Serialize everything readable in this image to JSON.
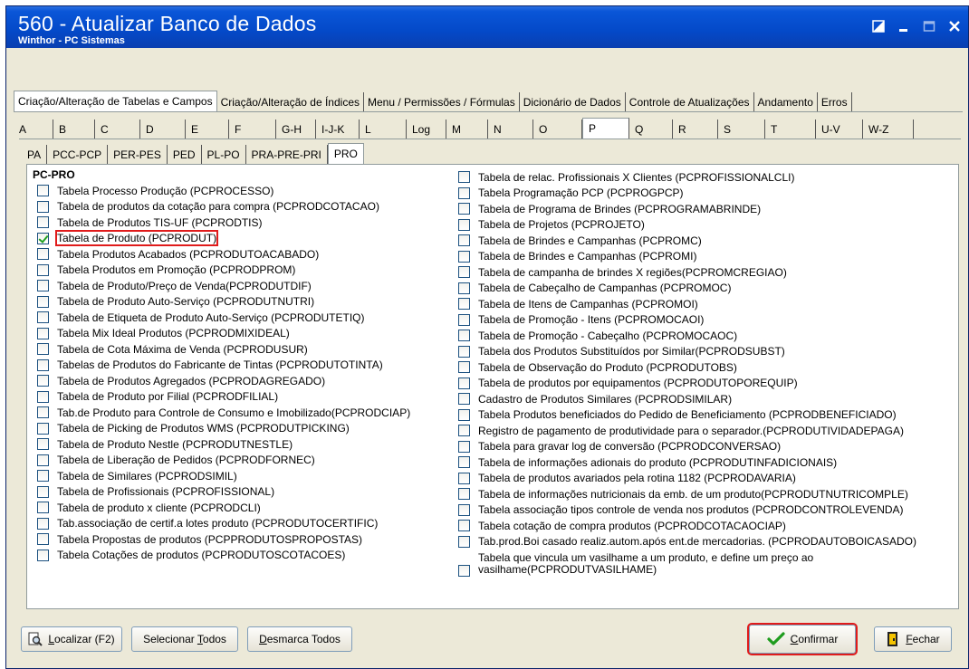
{
  "window": {
    "title": "560 - Atualizar Banco de Dados",
    "subtitle": "Winthor - PC Sistemas"
  },
  "main_tabs": [
    {
      "label": "Criação/Alteração de Tabelas e Campos",
      "active": true
    },
    {
      "label": "Criação/Alteração de Índices"
    },
    {
      "label": "Menu / Permissões / Fórmulas"
    },
    {
      "label": "Dicionário de Dados"
    },
    {
      "label": "Controle de Atualizações"
    },
    {
      "label": "Andamento"
    },
    {
      "label": "Erros"
    }
  ],
  "letter_tabs": [
    "A",
    "B",
    "C",
    "D",
    "E",
    "F",
    "G-H",
    "I-J-K",
    "L",
    "Log",
    "M",
    "N",
    "O",
    "P",
    "Q",
    "R",
    "S",
    "T",
    "U-V",
    "W-Z"
  ],
  "active_letter": "P",
  "sub_tabs": [
    "PA",
    "PCC-PCP",
    "PER-PES",
    "PED",
    "PL-PO",
    "PRA-PRE-PRI",
    "PRO"
  ],
  "active_sub": "PRO",
  "group_label": "PC-PRO",
  "left_items": [
    {
      "label": "Tabela Processo Produção (PCPROCESSO)"
    },
    {
      "label": "Tabela de produtos da cotação para compra (PCPRODCOTACAO)"
    },
    {
      "label": "Tabela de Produtos TIS-UF (PCPRODTIS)"
    },
    {
      "label": "Tabela de Produto (PCPRODUT)",
      "checked": true,
      "highlight": true
    },
    {
      "label": "Tabela Produtos Acabados (PCPRODUTOACABADO)"
    },
    {
      "label": "Tabela Produtos em Promoção (PCPRODPROM)"
    },
    {
      "label": "Tabela de Produto/Preço de Venda(PCPRODUTDIF)"
    },
    {
      "label": "Tabela de Produto Auto-Serviço (PCPRODUTNUTRI)"
    },
    {
      "label": "Tabela de Etiqueta de Produto Auto-Serviço (PCPRODUTETIQ)"
    },
    {
      "label": "Tabela Mix Ideal Produtos (PCPRODMIXIDEAL)"
    },
    {
      "label": "Tabela de Cota Máxima de Venda (PCPRODUSUR)"
    },
    {
      "label": "Tabelas de Produtos do Fabricante de Tintas (PCPRODUTOTINTA)"
    },
    {
      "label": "Tabela de Produtos Agregados (PCPRODAGREGADO)"
    },
    {
      "label": "Tabela de Produto por Filial (PCPRODFILIAL)"
    },
    {
      "label": "Tab.de Produto para Controle de Consumo e Imobilizado(PCPRODCIAP)"
    },
    {
      "label": "Tabela de Picking de Produtos WMS (PCPRODUTPICKING)"
    },
    {
      "label": "Tabela de Produto Nestle (PCPRODUTNESTLE)"
    },
    {
      "label": "Tabela de Liberação de Pedidos (PCPRODFORNEC)"
    },
    {
      "label": "Tabela de Similares (PCPRODSIMIL)"
    },
    {
      "label": "Tabela de Profissionais (PCPROFISSIONAL)"
    },
    {
      "label": "Tabela de produto x cliente (PCPRODCLI)"
    },
    {
      "label": "Tab.associação de certif.a lotes produto (PCPRODUTOCERTIFIC)"
    },
    {
      "label": "Tabela Propostas de produtos (PCPPRODUTOSPROPOSTAS)"
    },
    {
      "label": "Tabela Cotações de produtos (PCPRODUTOSCOTACOES)"
    }
  ],
  "right_items": [
    {
      "label": "Tabela de relac. Profissionais X Clientes (PCPROFISSIONALCLI)"
    },
    {
      "label": "Tabela Programação PCP (PCPROGPCP)"
    },
    {
      "label": "Tabela de Programa de Brindes (PCPROGRAMABRINDE)"
    },
    {
      "label": "Tabela de Projetos (PCPROJETO)"
    },
    {
      "label": "Tabela de Brindes e Campanhas  (PCPROMC)"
    },
    {
      "label": "Tabela de Brindes e Campanhas  (PCPROMI)"
    },
    {
      "label": "Tabela de campanha de brindes X regiões(PCPROMCREGIAO)"
    },
    {
      "label": "Tabela de Cabeçalho de Campanhas  (PCPROMOC)"
    },
    {
      "label": "Tabela de Itens de Campanhas  (PCPROMOI)"
    },
    {
      "label": "Tabela de Promoção - Itens (PCPROMOCAOI)"
    },
    {
      "label": "Tabela de Promoção - Cabeçalho (PCPROMOCAOC)"
    },
    {
      "label": "Tabela dos Produtos Substituídos por Similar(PCPRODSUBST)"
    },
    {
      "label": "Tabela de Observação do Produto (PCPRODUTOBS)"
    },
    {
      "label": "Tabela de produtos por equipamentos (PCPRODUTOPOREQUIP)"
    },
    {
      "label": "Cadastro de Produtos Similares (PCPRODSIMILAR)"
    },
    {
      "label": "Tabela Produtos beneficiados do Pedido de Beneficiamento (PCPRODBENEFICIADO)"
    },
    {
      "label": "Registro de pagamento de produtividade para o separador.(PCPRODUTIVIDADEPAGA)"
    },
    {
      "label": "Tabela para gravar log de conversão (PCPRODCONVERSAO)"
    },
    {
      "label": "Tabela de informações adionais do produto (PCPRODUTINFADICIONAIS)"
    },
    {
      "label": "Tabela de produtos avariados pela rotina 1182 (PCPRODAVARIA)"
    },
    {
      "label": "Tabela de informações nutricionais da emb. de um produto(PCPRODUTNUTRICOMPLE)"
    },
    {
      "label": "Tabela associação tipos controle de venda nos produtos (PCPRODCONTROLEVENDA)"
    },
    {
      "label": "Tabela cotação de compra produtos (PCPRODCOTACAOCIAP)"
    },
    {
      "label": "Tab.prod.Boi casado realiz.autom.após ent.de mercadorias. (PCPRODAUTOBOICASADO)"
    },
    {
      "label": "Tabela que vincula um vasilhame a um produto, e define um preço ao vasilhame(PCPRODUTVASILHAME)",
      "tall": true
    }
  ],
  "buttons": {
    "localizar_u": "L",
    "localizar_rest": "ocalizar (F2)",
    "selecionar_pre": "Selecionar ",
    "selecionar_u": "T",
    "selecionar_rest": "odos",
    "desmarca_u": "D",
    "desmarca_rest": "esmarca Todos",
    "confirmar_u": "C",
    "confirmar_rest": "onfirmar",
    "fechar_u": "F",
    "fechar_rest": "echar"
  },
  "colors": {
    "title_bar": "#0449c8",
    "window_bg": "#ece9d8",
    "highlight": "#e01b1b",
    "check": "#21a121"
  }
}
